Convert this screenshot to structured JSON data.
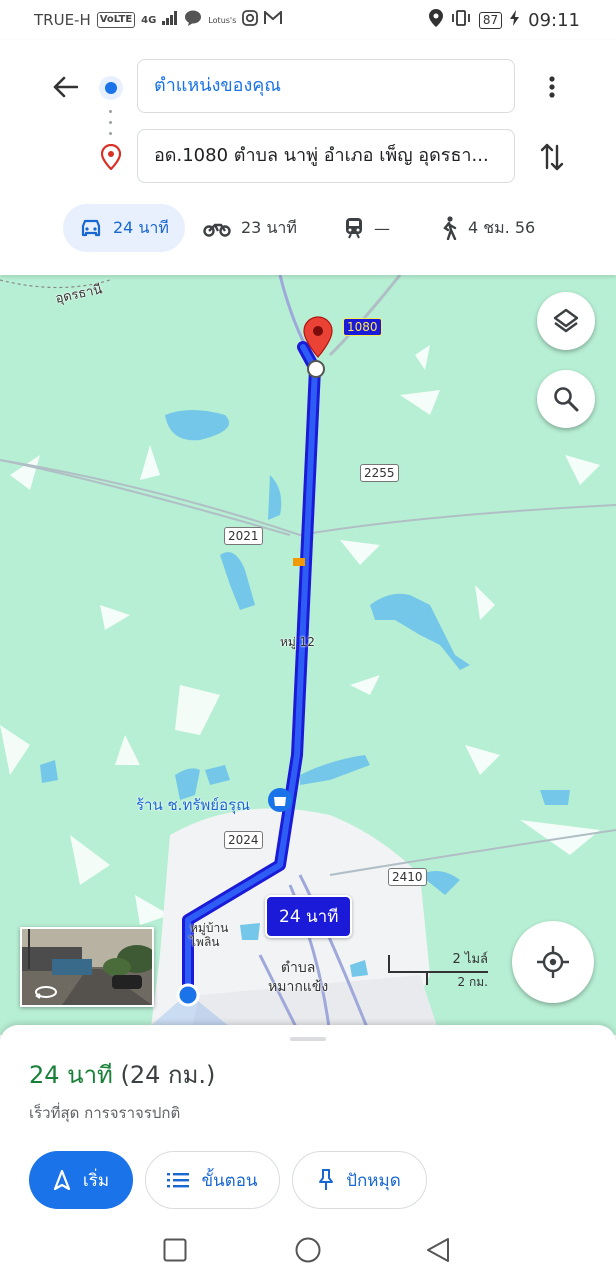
{
  "status_bar": {
    "carrier": "TRUE-H",
    "volte": "VoLTE",
    "network": "4G",
    "battery": "87",
    "time": "09:11"
  },
  "header": {
    "origin": "ตำแหน่งของคุณ",
    "destination": "อด.1080 ตำบล นาพู่ อำเภอ เพ็ญ อุดรธา...",
    "modes": [
      {
        "icon": "car-icon",
        "label": "24 นาที"
      },
      {
        "icon": "motorcycle-icon",
        "label": "23 นาที"
      },
      {
        "icon": "train-icon",
        "label": "—"
      },
      {
        "icon": "walk-icon",
        "label": "4 ชม. 56"
      }
    ]
  },
  "map": {
    "place_top_left": "อุดรธานี",
    "road_1080": "1080",
    "road_2255": "2255",
    "road_2021": "2021",
    "road_2024": "2024",
    "road_2410": "2410",
    "village_12": "หมู่ 12",
    "shop_name": "ร้าน ช.ทรัพย์อรุณ",
    "village_pailin": "หมู่บ้าน\nไพลิน",
    "district": "ตำบล\nหมากแข้ง",
    "route_duration": "24 นาที",
    "scale_miles": "2 ไมล์",
    "scale_km": "2 กม.",
    "colors": {
      "route": "#1a1ad8",
      "water": "#74c7e8",
      "land": "#b7efd4",
      "pin": "#ea4335"
    }
  },
  "sheet": {
    "duration": "24 นาที",
    "distance": "(24 กม.)",
    "subtitle": "เร็วที่สุด การจราจรปกติ",
    "start_label": "เริ่ม",
    "steps_label": "ขั้นตอน",
    "pin_label": "ปักหมุด"
  }
}
